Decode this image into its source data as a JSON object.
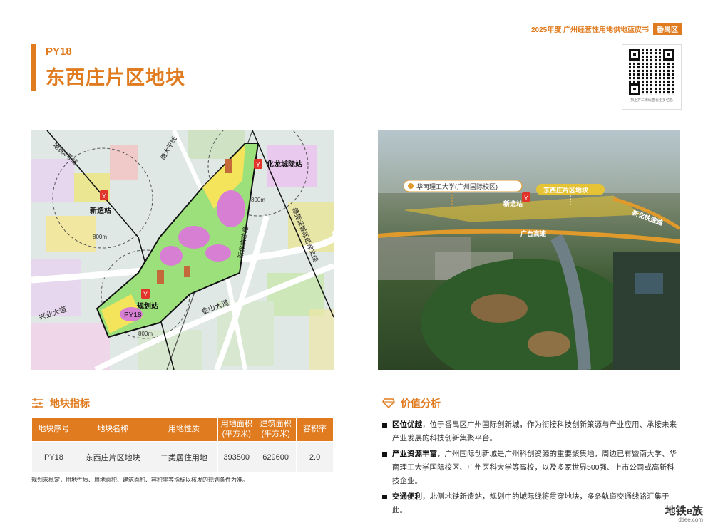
{
  "header": {
    "book_title": "2025年度 广州经营性用地供地蓝皮书",
    "district": "番禺区"
  },
  "plot": {
    "code": "PY18",
    "title": "东西庄片区地块"
  },
  "qr": {
    "caption": "扫上方二维码查看更多信息"
  },
  "map": {
    "labels": {
      "metro4": "地铁4号线",
      "nanda": "南大干线",
      "huanglong_station": "化龙城际站",
      "xinzao_station": "新造站",
      "guihua_station": "规划站",
      "plot": "PY18",
      "xingye": "兴业大道",
      "jinshan": "金山大道",
      "xinhua": "新化快速路",
      "intercity": "穗莞深城际延伸支线",
      "r800a": "800m",
      "r800b": "800m",
      "r800c": "800m"
    },
    "colors": {
      "residential": "#F4E45C",
      "commercial": "#D77FD2",
      "green": "#9BE07A",
      "boundary": "#111111",
      "metro": "#E2342B"
    }
  },
  "aerial": {
    "labels": {
      "university": "华南理工大学(广州国际校区)",
      "xinzao": "新造站",
      "plot": "东西庄片区地块",
      "guangtai": "广台高速",
      "xinhua": "新化快速路"
    }
  },
  "indicators": {
    "heading": "地块指标",
    "columns": [
      "地块序号",
      "地块名称",
      "用地性质",
      "用地面积\n(平方米)",
      "建筑面积\n(平方米)",
      "容积率"
    ],
    "row": [
      "PY18",
      "东西庄片区地块",
      "二类居住用地",
      "393500",
      "629600",
      "2.0"
    ],
    "note": "规划未稳定，用地性质、用地面积、建筑面积、容积率等指标以核发的规划条件为准。"
  },
  "value": {
    "heading": "价值分析",
    "items": [
      {
        "title": "区位优越",
        "text": "，位于番禺区广州国际创新城，作为衔接科技创新策源与产业应用、承接未来产业发展的科技创新集聚平台。"
      },
      {
        "title": "产业资源丰富",
        "text": "，广州国际创新城是广州科创资源的重要聚集地，周边已有暨南大学、华南理工大学国际校区、广州医科大学等高校，以及多家世界500强、上市公司或高新科技企业。"
      },
      {
        "title": "交通便利",
        "text": "，北侧地铁新造站，规划中的城际线将贯穿地块，多条轨道交通线路汇集于此。"
      }
    ]
  },
  "watermark": {
    "brand": "地铁e族",
    "site": "dtiee.com"
  }
}
